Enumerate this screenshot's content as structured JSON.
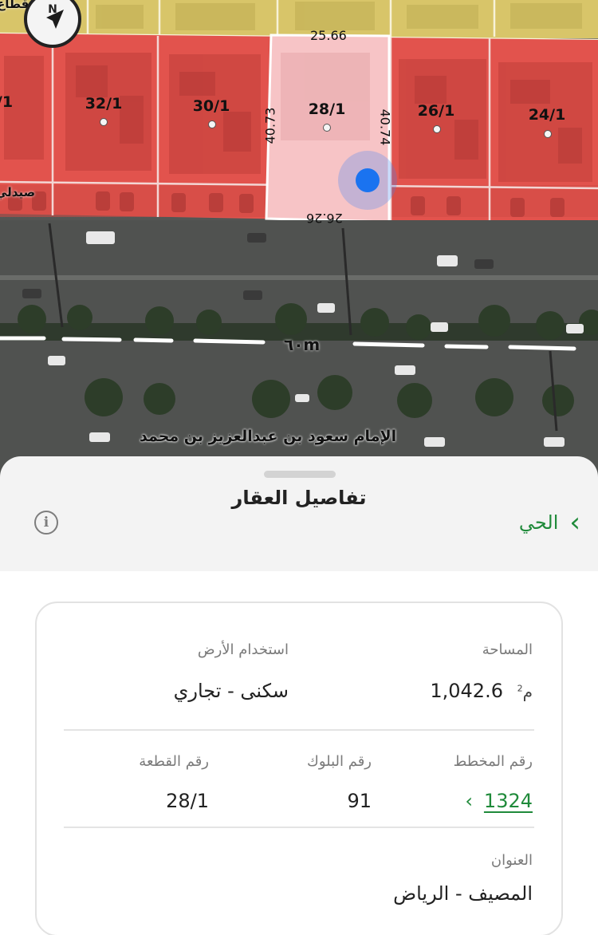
{
  "map": {
    "parcels": [
      {
        "id": "parcel-edge-left",
        "label": "/1",
        "highlighted": false
      },
      {
        "id": "parcel-32",
        "label": "32/1",
        "highlighted": false
      },
      {
        "id": "parcel-30",
        "label": "30/1",
        "highlighted": false
      },
      {
        "id": "parcel-28",
        "label": "28/1",
        "highlighted": true
      },
      {
        "id": "parcel-26",
        "label": "26/1",
        "highlighted": false
      },
      {
        "id": "parcel-24",
        "label": "24/1",
        "highlighted": false
      }
    ],
    "dimensions": {
      "top": "25.66",
      "bottom": "26.26",
      "left": "40.73",
      "right": "40.74"
    },
    "road_name": "الإمام سعود بن عبدالعزيز بن محمد",
    "road_width": "٦٠m",
    "edge_text_top": "قطاع",
    "edge_text_left": "صيدلي",
    "compass_label": "N",
    "colors": {
      "parcels": "#e8534d",
      "highlighted_parcel": "#f6c2c4",
      "upper_block": "#d9c66a",
      "location": "#1a73f0"
    }
  },
  "sheet": {
    "title": "تفاصيل العقار",
    "neighborhood_label": "الحي",
    "info_icon": "info-icon",
    "fields": {
      "area_label": "المساحة",
      "area_value": "1,042.6",
      "area_unit": "م",
      "area_unit_sup": "2",
      "land_use_label": "استخدام الأرض",
      "land_use_value": "سكنى - تجاري",
      "plan_label": "رقم المخطط",
      "plan_value": "1324",
      "block_label": "رقم البلوك",
      "block_value": "91",
      "plot_label": "رقم القطعة",
      "plot_value": "28/1",
      "address_label": "العنوان",
      "address_value": "المصيف - الرياض"
    }
  }
}
